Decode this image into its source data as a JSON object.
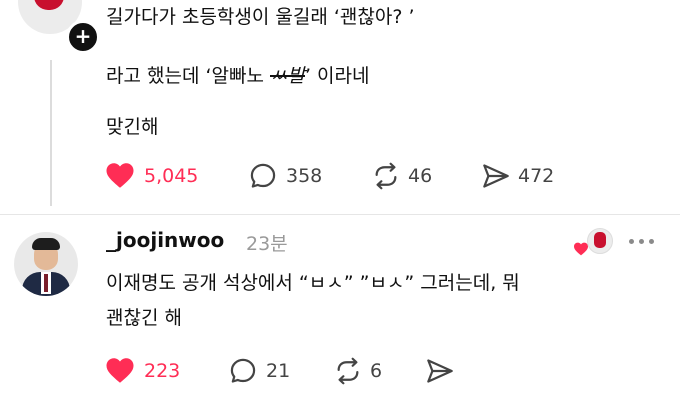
{
  "post": {
    "line1": "길가다가 초등학생이 울길래 ‘괜찮아? ’",
    "line2_prefix": "라고 했는데 ‘알빠노 ",
    "line2_strike": "ㅆ발",
    "line2_suffix": "’ 이라네",
    "line3": "맞긴해",
    "likes": "5,045",
    "comments": "358",
    "reposts": "46",
    "shares": "472"
  },
  "reply": {
    "username": "_joojinwoo",
    "time": "23분",
    "line1": "이재명도 공개 석상에서 “ㅂㅅ” ”ㅂㅅ” 그러는데, 뭐",
    "line2": "괜찮긴 해",
    "likes": "223",
    "comments": "21",
    "reposts": "6"
  },
  "icons": {
    "follow": "plus-icon",
    "like": "heart-icon",
    "comment": "comment-bubble-icon",
    "repost": "repost-icon",
    "share": "send-icon",
    "more": "more-dots-icon"
  },
  "colors": {
    "like_red": "#ff2d55",
    "text": "#111111",
    "muted": "#9a9a9a",
    "icon_gray": "#444444"
  }
}
